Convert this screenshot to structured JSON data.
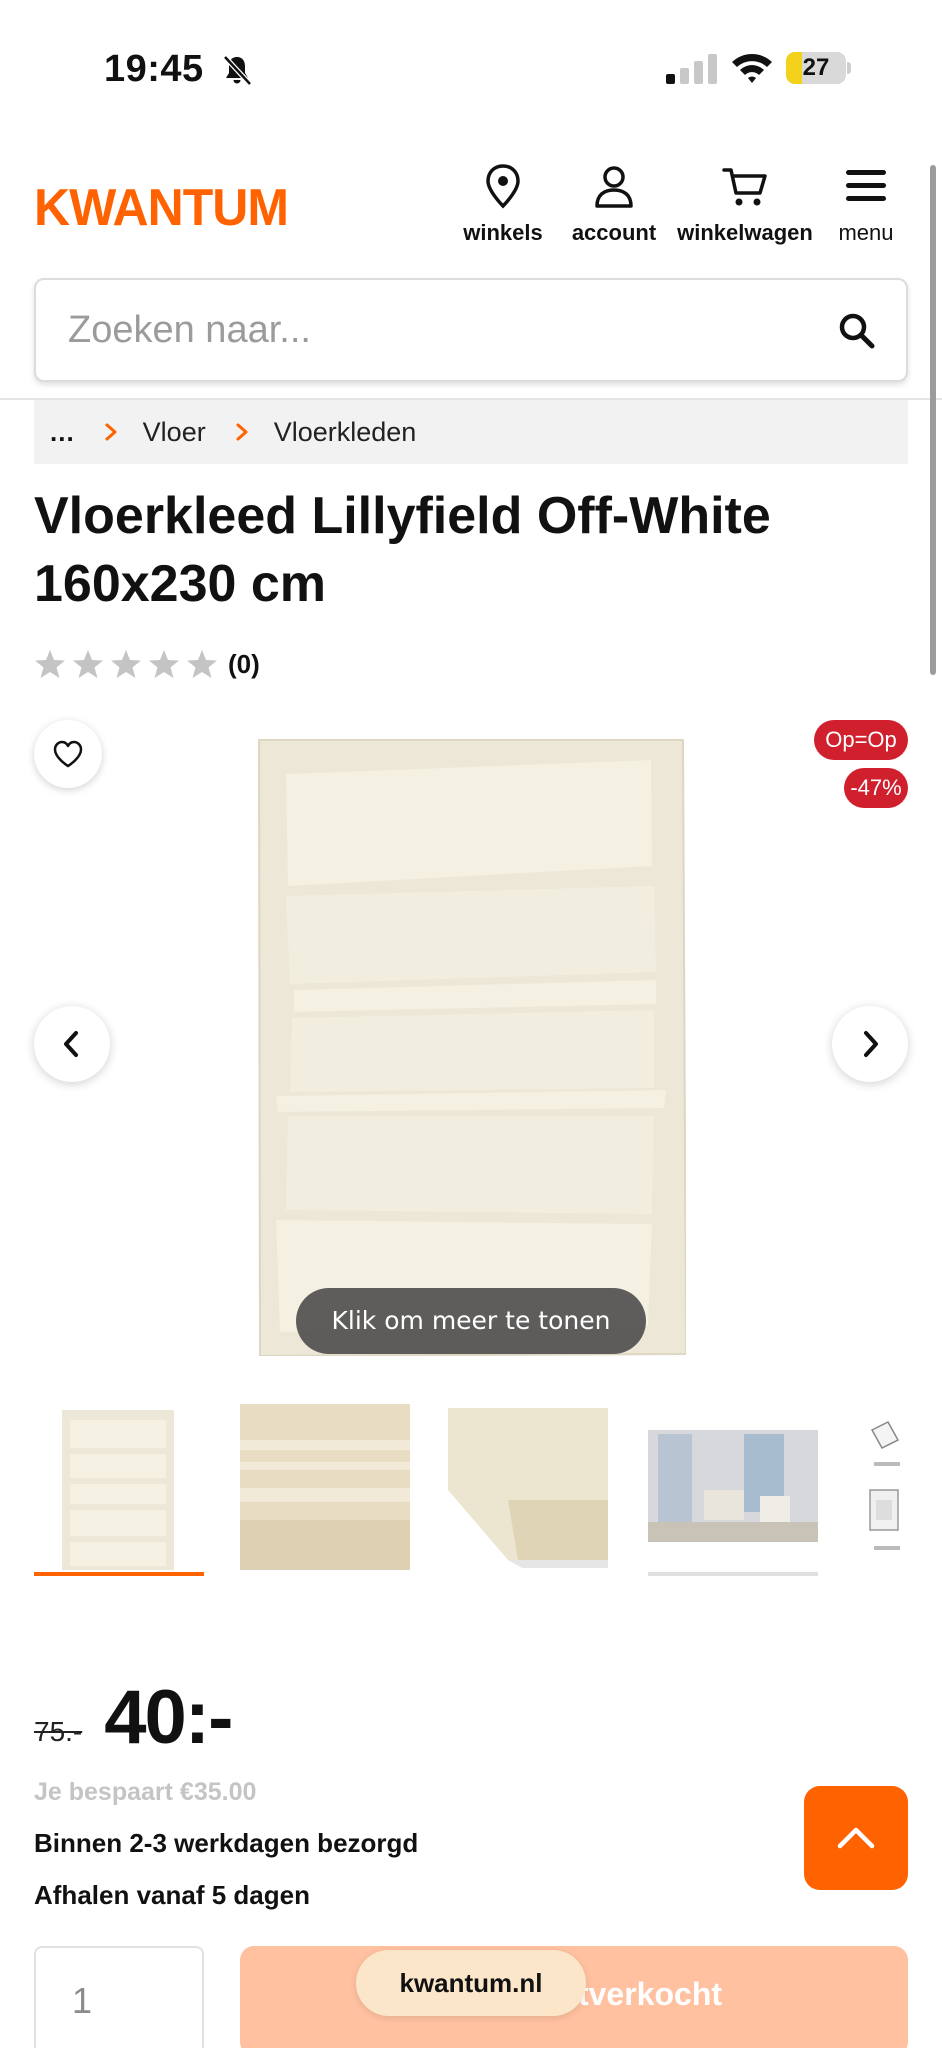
{
  "status_bar": {
    "time": "19:45",
    "battery": "27",
    "battery_level": 0.27
  },
  "header": {
    "logo": "KWANTUM",
    "nav": {
      "stores": "winkels",
      "account": "account",
      "cart": "winkelwagen",
      "menu": "menu"
    }
  },
  "search": {
    "placeholder": "Zoeken naar..."
  },
  "breadcrumb": {
    "ellipsis": "...",
    "items": [
      "Vloer",
      "Vloerkleden"
    ]
  },
  "product": {
    "title": "Vloerkleed Lillyfield Off-White 160x230 cm",
    "rating": {
      "stars": 0,
      "max": 5,
      "count": "(0)"
    },
    "badges": {
      "op_op": "Op=Op",
      "discount": "-47%"
    },
    "gallery_overlay": "Klik om meer te tonen",
    "price": {
      "old": "75.-",
      "new": "40:-",
      "savings": "Je bespaart €35.00"
    },
    "delivery": "Binnen 2-3 werkdagen bezorgd",
    "pickup": "Afhalen vanaf 5 dagen"
  },
  "purchase": {
    "quantity": "1",
    "button_label": "Uitverkocht"
  },
  "browser": {
    "domain": "kwantum.nl"
  },
  "colors": {
    "brand": "#ff6200",
    "badge": "#d0202e",
    "rug": "#ece7d6",
    "button_disabled": "#ffc1a0"
  }
}
